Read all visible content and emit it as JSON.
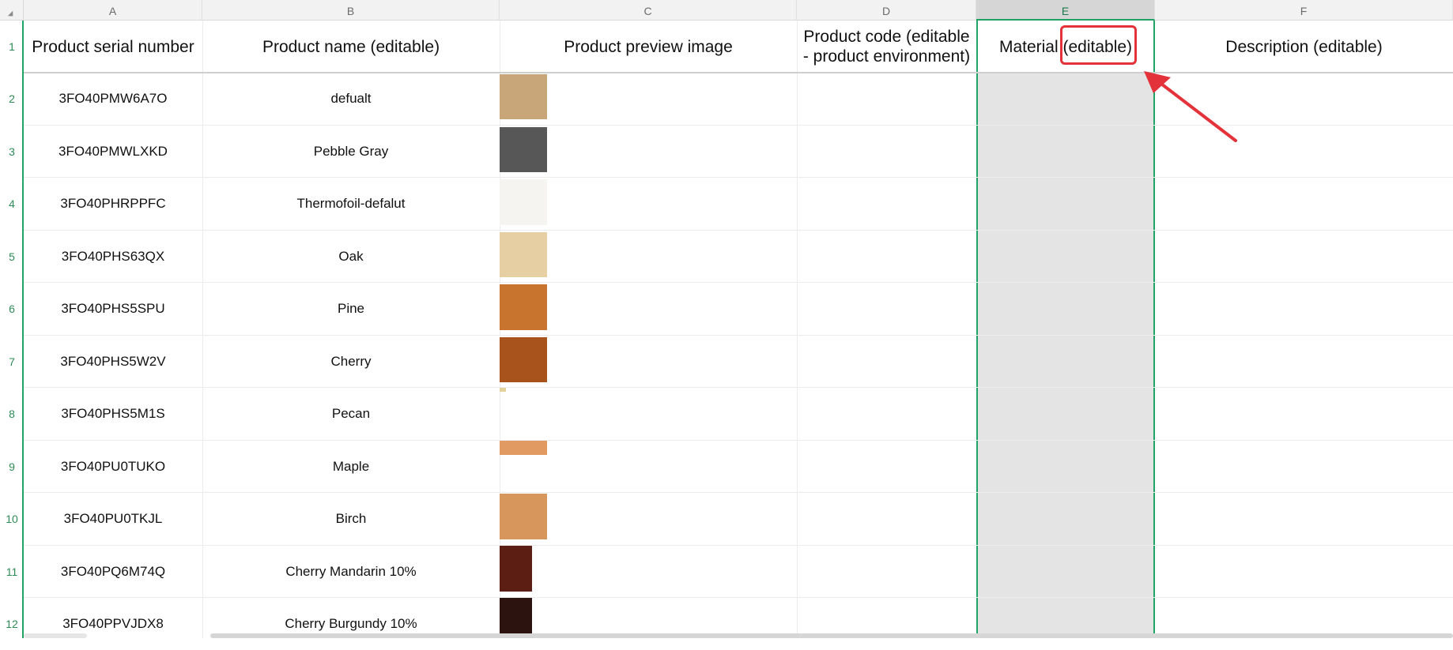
{
  "columns": [
    "A",
    "B",
    "C",
    "D",
    "E",
    "F"
  ],
  "selected_column": "E",
  "header_row": {
    "A": "Product serial number",
    "B": "Product name (editable)",
    "C": "Product preview image",
    "D": "Product code (editable - product environment)",
    "E_prefix": "Material ",
    "E_suffix": "(editable)",
    "F": "Description (editable)"
  },
  "row_numbers": [
    "1",
    "2",
    "3",
    "4",
    "5",
    "6",
    "7",
    "8",
    "9",
    "10",
    "11",
    "12"
  ],
  "rows": [
    {
      "serial": "3FO40PMW6A7O",
      "name": "defualt",
      "swatch_color": "#c9a57a"
    },
    {
      "serial": "3FO40PMWLXKD",
      "name": "Pebble Gray",
      "swatch_color": "#575757"
    },
    {
      "serial": "3FO40PHRPPFC",
      "name": "Thermofoil-defalut",
      "swatch_color": "#f5f4f0"
    },
    {
      "serial": "3FO40PHS63QX",
      "name": "Oak",
      "swatch_color": "#e6cfa2"
    },
    {
      "serial": "3FO40PHS5SPU",
      "name": "Pine",
      "swatch_color": "#c8742e"
    },
    {
      "serial": "3FO40PHS5W2V",
      "name": "Cherry",
      "swatch_color": "#a8521c"
    },
    {
      "serial": "3FO40PHS5M1S",
      "name": "Pecan",
      "swatch_color": "#e3d39a"
    },
    {
      "serial": "3FO40PU0TUKO",
      "name": "Maple",
      "swatch_color": "#e29a63"
    },
    {
      "serial": "3FO40PU0TKJL",
      "name": "Birch",
      "swatch_color": "#d7975c"
    },
    {
      "serial": "3FO40PQ6M74Q",
      "name": "Cherry Mandarin 10%",
      "swatch_color": "#5c1d12"
    },
    {
      "serial": "3FO40PPVJDX8",
      "name": "Cherry Burgundy 10%",
      "swatch_color": "#2c1310"
    }
  ],
  "colors": {
    "selection_green": "#21a366",
    "annotation_red": "#e3323a",
    "selected_column_fill": "#e4e4e4"
  }
}
